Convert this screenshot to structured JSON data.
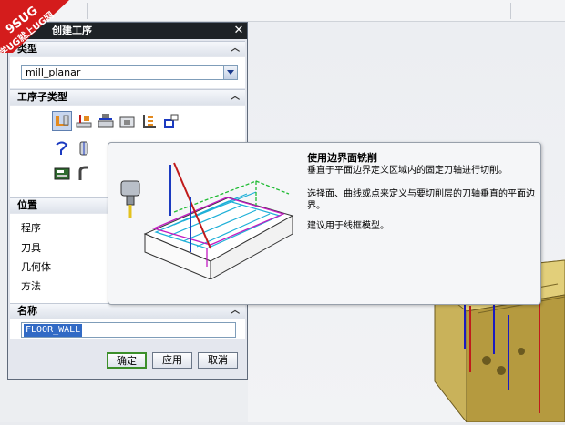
{
  "dialog": {
    "title": "创建工序",
    "close_glyph": "✕",
    "type_section": {
      "label": "类型",
      "value": "mill_planar"
    },
    "subtype_section": {
      "label": "工序子类型"
    },
    "position_section": {
      "label": "位置",
      "rows": [
        "程序",
        "刀具",
        "几何体",
        "方法"
      ]
    },
    "name_section": {
      "label": "名称",
      "value": "FLOOR_WALL"
    },
    "buttons": {
      "ok": "确定",
      "apply": "应用",
      "cancel": "取消"
    }
  },
  "tooltip": {
    "title": "使用边界面铣削",
    "line1": "垂直于平面边界定义区域内的固定刀轴进行切削。",
    "line2a": "选择面、曲线或点来定义与要切削层的刀轴垂直的平面边",
    "line2b": "界。",
    "line3": "建议用于线框模型。"
  },
  "watermark": {
    "top": "9SUG",
    "bottom": "学UG就上UG网"
  },
  "icons": {
    "subtypes_row1": [
      "floor-wall-icon",
      "planar-mill-icon",
      "face-milling-icon",
      "cavity-mill-icon",
      "zlevel-icon",
      "contour-icon"
    ],
    "subtypes_row2": [
      "planar-text-icon",
      "hole-mill-icon"
    ],
    "subtypes_row3": [
      "planar-profile-icon",
      "thread-mill-icon"
    ],
    "collapse": "chevron-up-icon"
  },
  "colors": {
    "title_bar": "#1e2226",
    "selection": "#316ac5",
    "default_button": "#3c8f2a",
    "part_gold": "#c9b25a"
  }
}
